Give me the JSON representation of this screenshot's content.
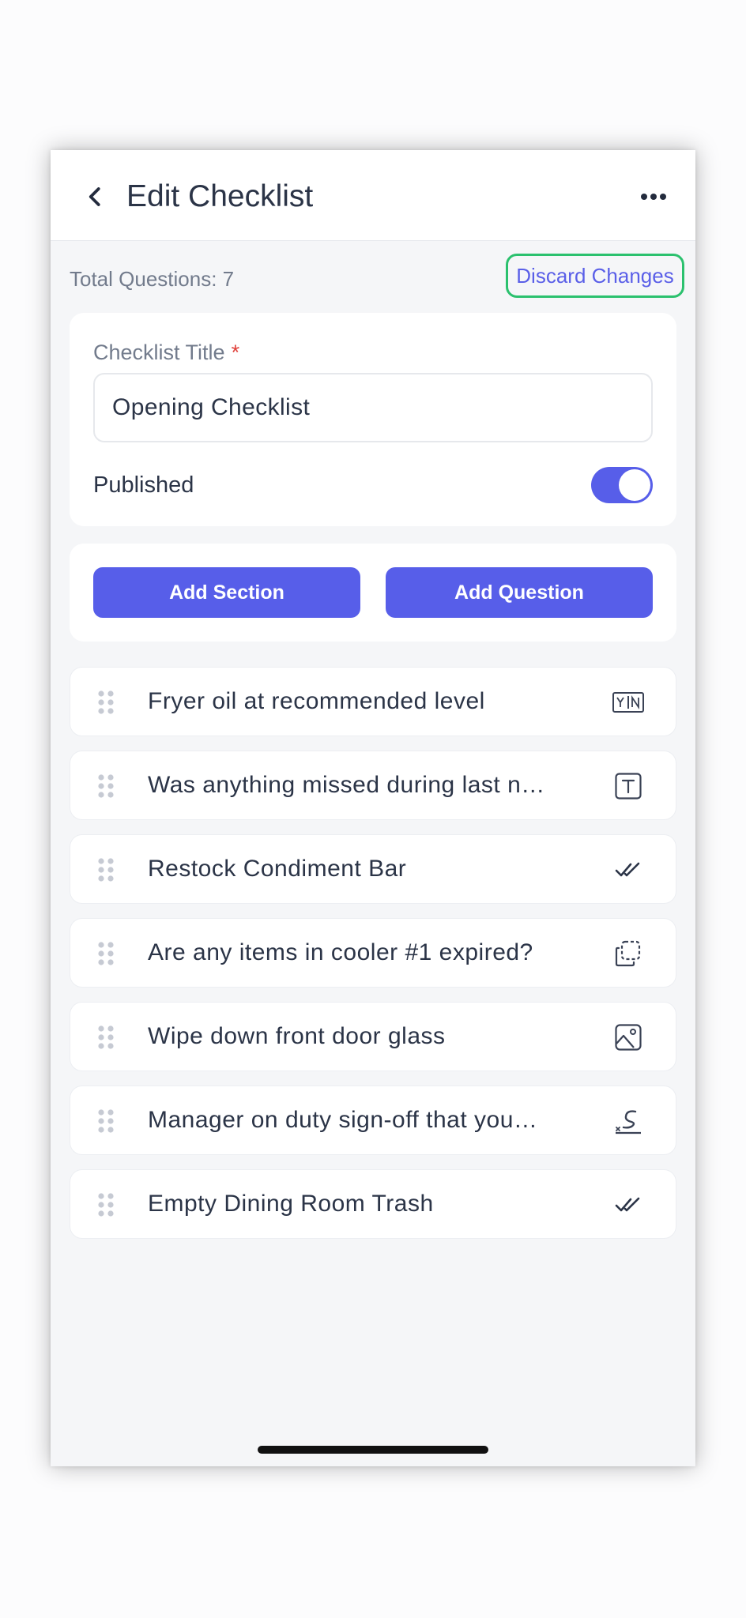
{
  "header": {
    "title": "Edit Checklist",
    "back_icon": "chevron-left-icon",
    "more_icon": "more-horizontal-icon"
  },
  "summary": {
    "total_label": "Total Questions: 7",
    "discard_label": "Discard Changes"
  },
  "form": {
    "title_label": "Checklist Title",
    "required_mark": "*",
    "title_value": "Opening Checklist",
    "published_label": "Published",
    "published": true
  },
  "actions": {
    "add_section": "Add Section",
    "add_question": "Add Question"
  },
  "questions": [
    {
      "text": "Fryer oil at recommended level",
      "type_icon": "yes-no-icon"
    },
    {
      "text": "Was anything missed during last n…",
      "type_icon": "text-icon"
    },
    {
      "text": "Restock Condiment Bar",
      "type_icon": "checkmark-icon"
    },
    {
      "text": "Are any items in cooler #1 expired?",
      "type_icon": "copy-icon"
    },
    {
      "text": "Wipe down front door glass",
      "type_icon": "image-icon"
    },
    {
      "text": "Manager on duty sign-off that you…",
      "type_icon": "signature-icon"
    },
    {
      "text": "Empty Dining Room Trash",
      "type_icon": "checkmark-icon"
    }
  ],
  "colors": {
    "accent": "#575ee9",
    "discard_border": "#2bc16e",
    "discard_text": "#5a5fe8",
    "required": "#e0403a",
    "text": "#2b3447",
    "muted": "#727b8c"
  }
}
